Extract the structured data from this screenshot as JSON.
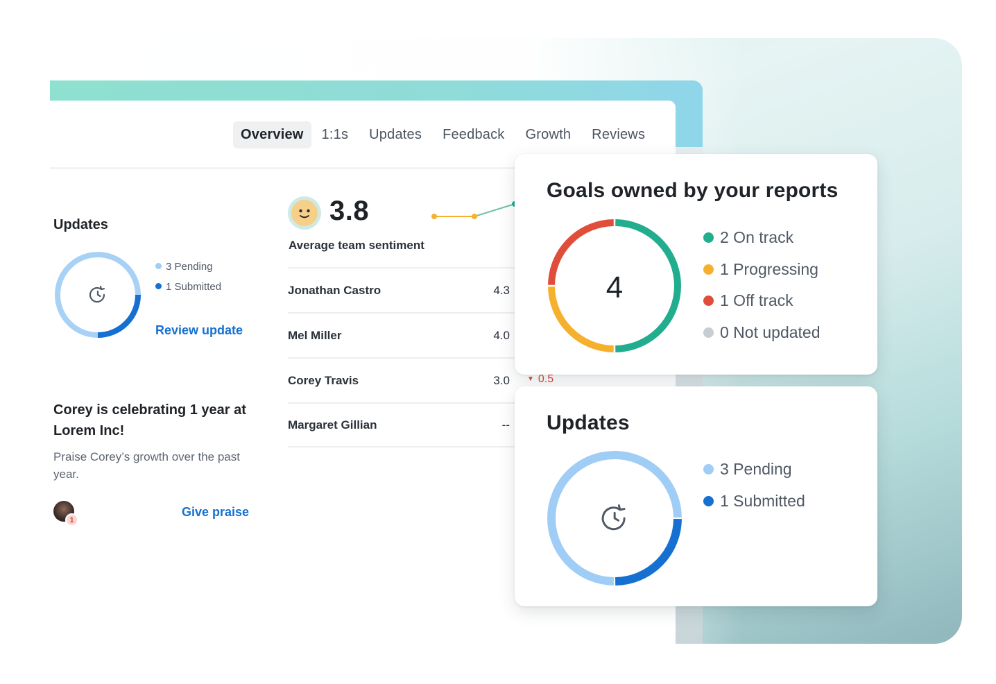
{
  "tabs": [
    {
      "label": "Overview",
      "active": true
    },
    {
      "label": "1:1s",
      "active": false
    },
    {
      "label": "Updates",
      "active": false
    },
    {
      "label": "Feedback",
      "active": false
    },
    {
      "label": "Growth",
      "active": false
    },
    {
      "label": "Reviews",
      "active": false
    }
  ],
  "left_panel": {
    "updates_title": "Updates",
    "pending_label": "3 Pending",
    "submitted_label": "1 Submitted",
    "review_link": "Review update",
    "celebration_title": "Corey is celebrating 1 year at Lorem Inc!",
    "praise_text": "Praise Corey’s growth over the past year.",
    "avatar_badge": "1",
    "give_praise_link": "Give praise"
  },
  "sentiment": {
    "score": "3.8",
    "label": "Average team sentiment",
    "rows": [
      {
        "name": "Jonathan Castro",
        "score": "4.3"
      },
      {
        "name": "Mel Miller",
        "score": "4.0"
      },
      {
        "name": "Corey Travis",
        "score": "3.0"
      },
      {
        "name": "Margaret Gillian",
        "score": "--"
      }
    ],
    "delta": "0.5"
  },
  "goals_card": {
    "title": "Goals owned by your reports",
    "total": "4",
    "legend": [
      {
        "label": "2 On track",
        "color": "#22ad8e",
        "count": 2
      },
      {
        "label": "1 Progressing",
        "color": "#f5b12e",
        "count": 1
      },
      {
        "label": "1 Off track",
        "color": "#e14d3b",
        "count": 1
      },
      {
        "label": "0 Not updated",
        "color": "#c7cdd1",
        "count": 0
      }
    ]
  },
  "updates_card": {
    "title": "Updates",
    "legend": [
      {
        "label": "3 Pending",
        "color": "#9fcdf5",
        "count": 3
      },
      {
        "label": "1 Submitted",
        "color": "#1670d1",
        "count": 1
      }
    ]
  },
  "colors": {
    "link": "#1670d1",
    "pending": "#9fcdf5",
    "submitted": "#1670d1",
    "negative": "#d9473d"
  },
  "icons": {
    "update_ring_icon": "clock-refresh-icon",
    "sentiment_icon": "smiley-face-icon",
    "delta_icon": "triangle-down-icon"
  }
}
